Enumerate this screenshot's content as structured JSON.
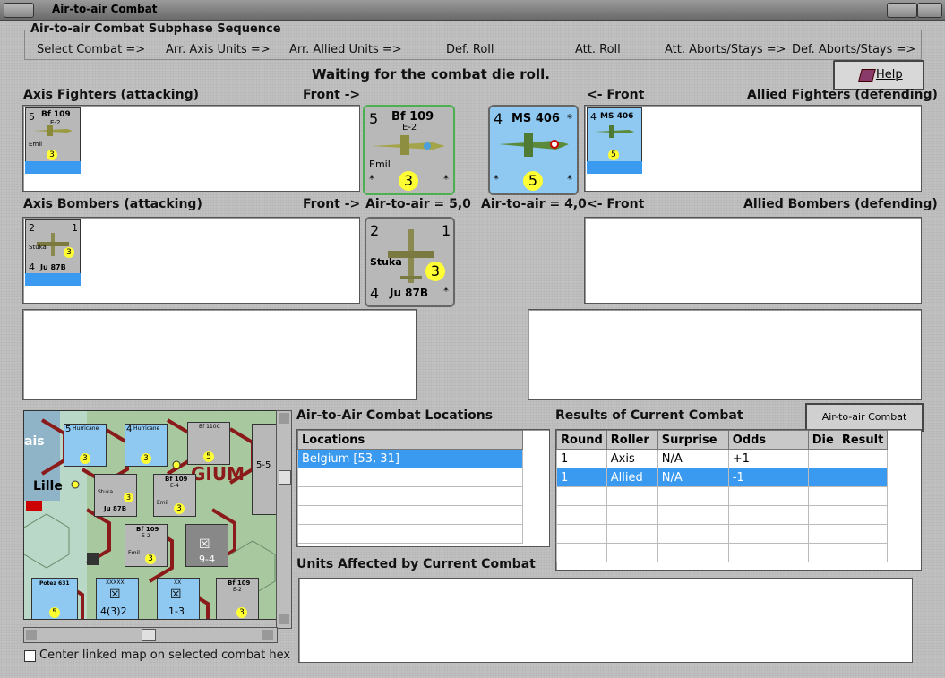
{
  "window": {
    "title": "Air-to-air Combat"
  },
  "sequence": {
    "title": "Air-to-air Combat Subphase Sequence",
    "steps": [
      "Select Combat =>",
      "Arr. Axis Units =>",
      "Arr. Allied Units =>",
      "Def. Roll",
      "Att. Roll",
      "Att. Aborts/Stays =>",
      "Def. Aborts/Stays =>"
    ]
  },
  "status": "Waiting for the combat die roll.",
  "help_label": "Help",
  "axis_fighters": {
    "label": "Axis Fighters (attacking)",
    "front": "Front ->",
    "unit": {
      "top_left": "5",
      "name": "Bf 109",
      "sub": "E-2",
      "pilot": "Emil",
      "value": "3",
      "star": "*"
    }
  },
  "allied_fighters": {
    "label": "Allied Fighters (defending)",
    "front": "<- Front",
    "unit": {
      "top_left": "4",
      "name": "MS 406",
      "value": "5",
      "star": "*"
    }
  },
  "axis_bombers": {
    "label": "Axis Bombers (attacking)",
    "front": "Front ->",
    "unit": {
      "top_left": "2",
      "top_right": "1",
      "name": "Stuka",
      "bottom_left": "4",
      "sub": "Ju 87B",
      "value": "3",
      "star": "*"
    }
  },
  "allied_bombers": {
    "label": "Allied Bombers (defending)",
    "front": "<- Front"
  },
  "air_to_air": {
    "axis": "Air-to-air = 5,0",
    "allied": "Air-to-air = 4,0"
  },
  "locations": {
    "title": "Air-to-Air Combat Locations",
    "header": "Locations",
    "rows": [
      "Belgium [53, 31]",
      "",
      "",
      "",
      "",
      ""
    ]
  },
  "results": {
    "title": "Results of Current Combat",
    "chart_button": "Air-to-air Combat Chart",
    "columns": [
      "Round",
      "Roller",
      "Surprise",
      "Odds",
      "Die",
      "Result"
    ],
    "rows": [
      [
        "1",
        "Axis",
        "N/A",
        "+1",
        "",
        ""
      ],
      [
        "1",
        "Allied",
        "N/A",
        "-1",
        "",
        ""
      ],
      [
        "",
        "",
        "",
        "",
        "",
        ""
      ],
      [
        "",
        "",
        "",
        "",
        "",
        ""
      ],
      [
        "",
        "",
        "",
        "",
        "",
        ""
      ],
      [
        "",
        "",
        "",
        "",
        "",
        ""
      ]
    ]
  },
  "units_affected": {
    "title": "Units Affected by Current Combat"
  },
  "map": {
    "labels": {
      "lille": "Lille",
      "ais": "ais",
      "belgium": "GIUM",
      "c1": "5",
      "c1n": "Hurricane",
      "c2": "4",
      "c2n": "Hurricane",
      "bf110": "Bf 110C",
      "potez": "Potez 631",
      "xxxx": "XXXXX",
      "d94": "9-4",
      "d432": "4(3)2",
      "d13": "1-3",
      "d55": "5-5",
      "gerorges": "Georges",
      "xx": "XX",
      "stuka": "Stuka",
      "ju87": "Ju 87B",
      "bf109": "Bf 109",
      "e2": "E-2",
      "emil": "Emil",
      "e4": "E-4",
      "n3": "3",
      "n5": "5",
      "n1": "1",
      "n2": "2",
      "n4": "4",
      "n6": "6",
      "xxx": "XXX"
    }
  },
  "center_checkbox": "Center linked map on selected combat hex",
  "colors": {
    "selection": "#3a9af0",
    "axis_counter": "#b8b8b8",
    "allied_counter": "#8fc8f0",
    "value_circle": "#ffff33",
    "hex_border": "#8b1a1a"
  }
}
